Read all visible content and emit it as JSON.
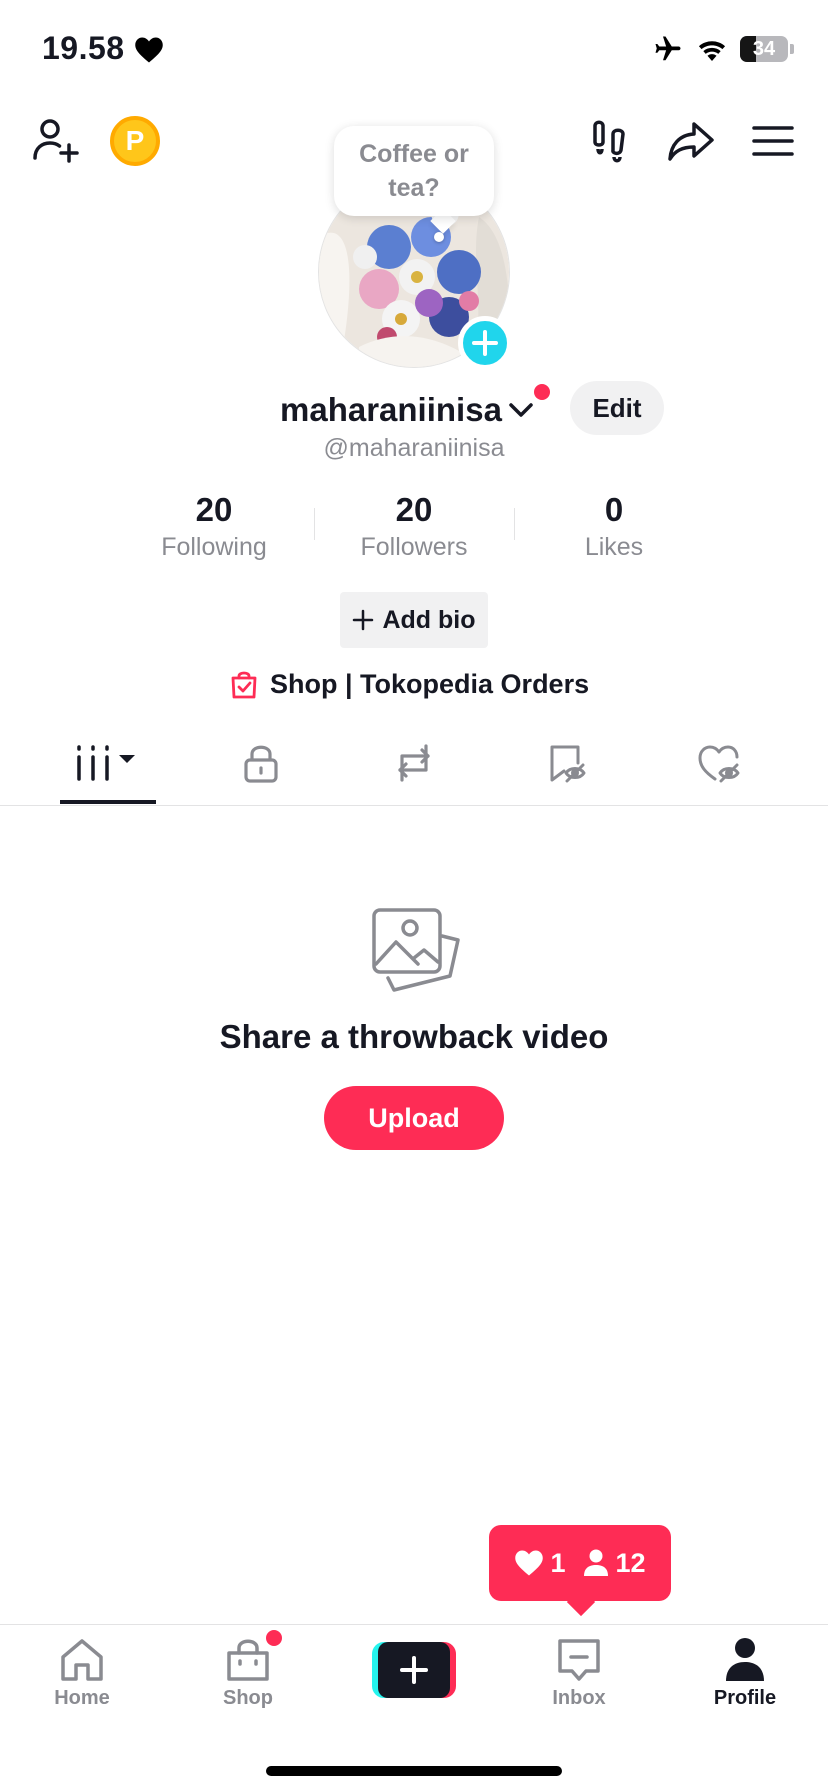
{
  "status_bar": {
    "time": "19.58",
    "battery": "34",
    "battery_level": 0.34
  },
  "avatar": {
    "note_bubble": "Coffee or tea?"
  },
  "profile": {
    "display_name": "maharaniinisa",
    "handle": "@maharaniinisa",
    "edit_label": "Edit",
    "add_bio_label": "Add bio",
    "shop_link_label": "Shop | Tokopedia Orders"
  },
  "stats": [
    {
      "value": "20",
      "label": "Following"
    },
    {
      "value": "20",
      "label": "Followers"
    },
    {
      "value": "0",
      "label": "Likes"
    }
  ],
  "tabs": [
    "videos-grid",
    "private",
    "reposts",
    "favorites-hidden",
    "liked-hidden"
  ],
  "empty_state": {
    "title": "Share a throwback video",
    "button_label": "Upload"
  },
  "notification": {
    "likes": "1",
    "followers": "12"
  },
  "bottom_nav": {
    "home": "Home",
    "shop": "Shop",
    "inbox": "Inbox",
    "profile": "Profile"
  },
  "colors": {
    "accent": "#fe2c55",
    "cyan": "#20d5ec",
    "text": "#161823",
    "muted": "#8a8b91"
  }
}
